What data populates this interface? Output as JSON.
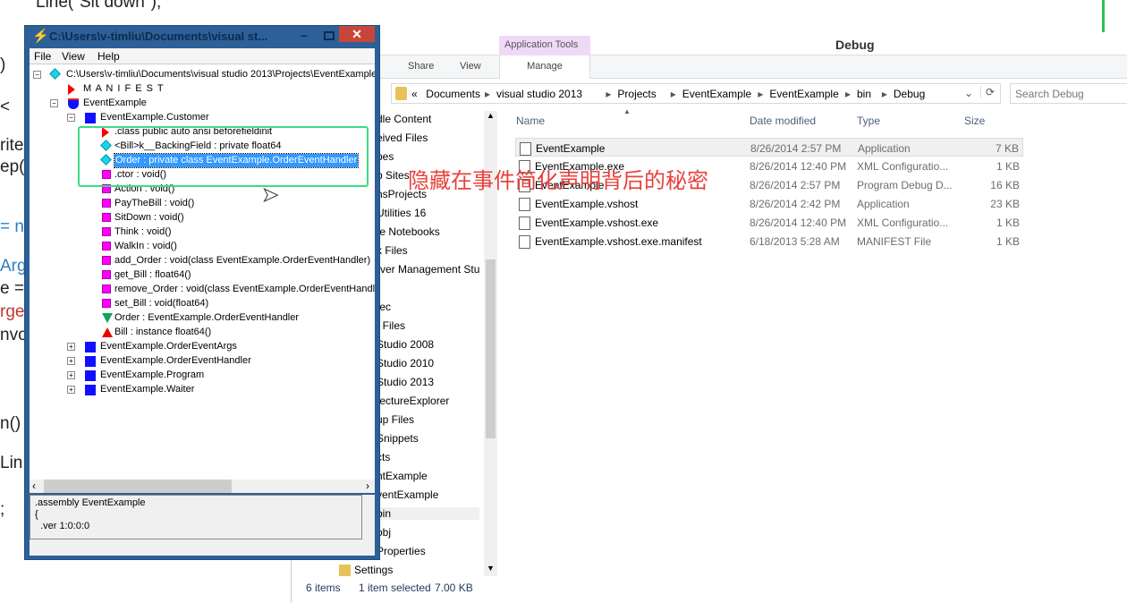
{
  "background_code": [
    "Line(\"Sit down\");",
    ")",
    "<",
    "rite",
    "ep(",
    "= n",
    "Arg",
    "e =",
    "rge",
    "nvo",
    "n()",
    "Lin",
    ";"
  ],
  "overlay_caption": "隐藏在事件简化声明背后的秘密",
  "ildasm": {
    "title": "C:\\Users\\v-timliu\\Documents\\visual st...",
    "menu": [
      "File",
      "View",
      "Help"
    ],
    "tree": [
      {
        "label": "C:\\Users\\v-timliu\\Documents\\visual studio 2013\\Projects\\EventExample\\E",
        "icon": "diamond-icon"
      },
      {
        "label": "M A N I F E S T",
        "icon": "red-triangle-icon"
      },
      {
        "label": "EventExample",
        "icon": "namespace-shield-icon"
      },
      {
        "label": "EventExample.Customer",
        "icon": "class-icon"
      },
      {
        "label": ".class public auto ansi beforefieldinit",
        "icon": "red-triangle-icon"
      },
      {
        "label": "<Bill>k__BackingField : private float64",
        "icon": "field-diamond-icon"
      },
      {
        "label": "Order : private class EventExample.OrderEventHandler",
        "icon": "field-diamond-icon",
        "selected": true
      },
      {
        "label": ".ctor : void()",
        "icon": "method-icon"
      },
      {
        "label": "Action : void()",
        "icon": "method-icon"
      },
      {
        "label": "PayTheBill : void()",
        "icon": "method-icon"
      },
      {
        "label": "SitDown : void()",
        "icon": "method-icon"
      },
      {
        "label": "Think : void()",
        "icon": "method-icon"
      },
      {
        "label": "WalkIn : void()",
        "icon": "method-icon"
      },
      {
        "label": "add_Order : void(class EventExample.OrderEventHandler)",
        "icon": "method-icon"
      },
      {
        "label": "get_Bill : float64()",
        "icon": "method-icon"
      },
      {
        "label": "remove_Order : void(class EventExample.OrderEventHandler)",
        "icon": "method-icon"
      },
      {
        "label": "set_Bill : void(float64)",
        "icon": "method-icon"
      },
      {
        "label": "Order : EventExample.OrderEventHandler",
        "icon": "event-icon"
      },
      {
        "label": "Bill : instance float64()",
        "icon": "property-icon"
      },
      {
        "label": "EventExample.OrderEventArgs",
        "icon": "class-icon"
      },
      {
        "label": "EventExample.OrderEventHandler",
        "icon": "class-icon"
      },
      {
        "label": "EventExample.Program",
        "icon": "class-icon"
      },
      {
        "label": "EventExample.Waiter",
        "icon": "class-icon"
      }
    ],
    "detail": ".assembly EventExample\n{\n  .ver 1:0:0:0"
  },
  "explorer": {
    "title": "Debug",
    "context_tab": "Application Tools",
    "ribbon_tabs": [
      "Share",
      "View",
      "Manage"
    ],
    "breadcrumb": [
      "«",
      "Documents",
      "visual studio 2013",
      "Projects",
      "EventExample",
      "EventExample",
      "bin",
      "Debug"
    ],
    "search_placeholder": "Search Debug",
    "nav_items": [
      "dle Content",
      "eived Files",
      "pes",
      "b Sites",
      "nsProjects",
      "Utilities 16",
      "te Notebooks",
      "k Files",
      "rver Management Stu",
      "",
      "tec",
      "t Files",
      "Studio 2008",
      "Studio 2010",
      "Studio 2013",
      "tectureExplorer",
      "up Files",
      "Snippets",
      "cts",
      "ntExample",
      "ventExample",
      "bin",
      "obj",
      "Properties",
      "Settings"
    ],
    "columns": [
      "Name",
      "Date modified",
      "Type",
      "Size"
    ],
    "files": [
      {
        "name": "EventExample",
        "date": "8/26/2014 2:57 PM",
        "type": "Application",
        "size": "7 KB"
      },
      {
        "name": "EventExample.exe",
        "date": "8/26/2014 12:40 PM",
        "type": "XML Configuratio...",
        "size": "1 KB"
      },
      {
        "name": "EventExample",
        "date": "8/26/2014 2:57 PM",
        "type": "Program Debug D...",
        "size": "16 KB"
      },
      {
        "name": "EventExample.vshost",
        "date": "8/26/2014 2:42 PM",
        "type": "Application",
        "size": "23 KB"
      },
      {
        "name": "EventExample.vshost.exe",
        "date": "8/26/2014 12:40 PM",
        "type": "XML Configuratio...",
        "size": "1 KB"
      },
      {
        "name": "EventExample.vshost.exe.manifest",
        "date": "6/18/2013 5:28 AM",
        "type": "MANIFEST File",
        "size": "1 KB"
      }
    ],
    "status": {
      "items": "6 items",
      "selected": "1 item selected",
      "size": "7.00 KB"
    }
  },
  "colors": {
    "highlight_box": "#3ddc84",
    "caption": "#e8403c",
    "selection": "#3399ff",
    "ildasm_frame": "#2d5f99"
  }
}
